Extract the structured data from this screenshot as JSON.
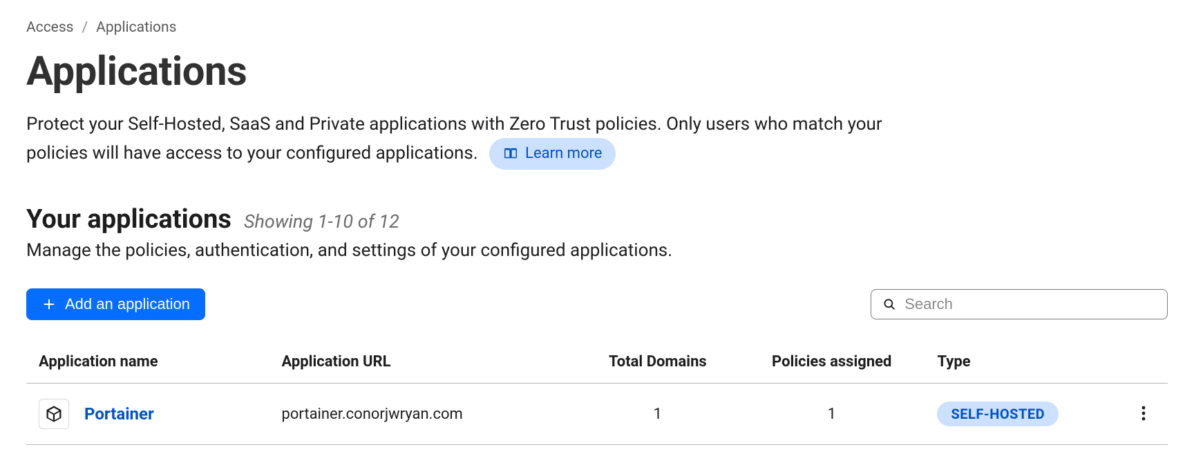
{
  "breadcrumb": {
    "parent": "Access",
    "current": "Applications"
  },
  "page": {
    "title": "Applications",
    "description_part1": "Protect your Self-Hosted, SaaS and Private applications with Zero Trust policies. Only users who match your policies will have access to your configured applications.",
    "learn_more": "Learn more"
  },
  "section": {
    "title": "Your applications",
    "showing": "Showing 1-10 of 12",
    "subtitle": "Manage the policies, authentication, and settings of your configured applications."
  },
  "toolbar": {
    "add_label": "Add an application",
    "search_placeholder": "Search"
  },
  "table": {
    "headers": {
      "name": "Application name",
      "url": "Application URL",
      "domains": "Total Domains",
      "policies": "Policies assigned",
      "type": "Type"
    },
    "rows": [
      {
        "name": "Portainer",
        "url": "portainer.conorjwryan.com",
        "total_domains": "1",
        "policies_assigned": "1",
        "type": "SELF-HOSTED"
      }
    ]
  }
}
